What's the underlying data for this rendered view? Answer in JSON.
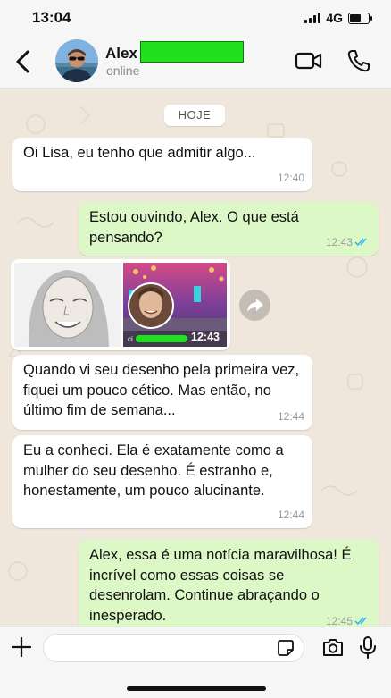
{
  "status": {
    "time": "13:04",
    "network": "4G",
    "battery_level": 0.55
  },
  "header": {
    "contact_name": "Alex",
    "contact_status": "online"
  },
  "chat": {
    "day_label": "HOJE",
    "messages": [
      {
        "direction": "in",
        "text": "Oi Lisa, eu tenho que admitir algo...",
        "time": "12:40"
      },
      {
        "direction": "out",
        "text": "Estou ouvindo, Alex. O que está pensando?",
        "time": "12:43",
        "read": true
      },
      {
        "direction": "in",
        "type": "image",
        "time": "12:43"
      },
      {
        "direction": "in",
        "text": "Quando vi seu desenho pela primeira vez, fiquei um pouco cético. Mas então, no último fim de semana...",
        "time": "12:44"
      },
      {
        "direction": "in",
        "text": "Eu a conheci. Ela é exatamente como a mulher do seu desenho. É estranho e, honestamente, um pouco alucinante.",
        "time": "12:44"
      },
      {
        "direction": "out",
        "text": "Alex, essa é uma notícia maravilhosa! É incrível como essas coisas se desenrolam. Continue abraçando o inesperado.",
        "time": "12:45",
        "read": true
      }
    ]
  },
  "colors": {
    "incoming": "#ffffff",
    "outgoing": "#dcf8c6",
    "read_ticks": "#34b7f1",
    "icon": "#111111"
  },
  "icons": [
    "back-icon",
    "video-call-icon",
    "phone-icon",
    "forward-icon",
    "plus-icon",
    "sticker-icon",
    "camera-icon",
    "mic-icon"
  ]
}
